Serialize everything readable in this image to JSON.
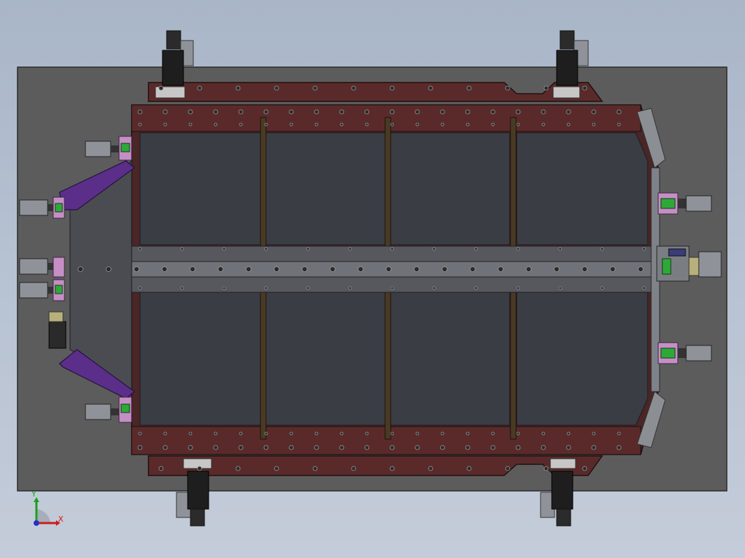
{
  "viewport": {
    "background_top": "#a9b6c8",
    "background_bottom": "#c4ccd9"
  },
  "colors": {
    "base_plate": "#5c5c5c",
    "frame_red": "#5a2a2a",
    "panel_dark": "#3b3d45",
    "rail_gray": "#6f7278",
    "rail_steel": "#8b8e93",
    "bracket_purple": "#5b2e8a",
    "clamp_pink": "#c58fc5",
    "block_green": "#2fa83a",
    "cylinder_gray": "#8f9399",
    "yellow_part": "#b7b07a",
    "navy_part": "#3a3c78"
  },
  "triad": {
    "x_label": "X",
    "y_label": "Y",
    "x_color": "#d01a1a",
    "y_color": "#19a019",
    "z_color": "#2430c8",
    "icon": "axis-triad-icon"
  }
}
